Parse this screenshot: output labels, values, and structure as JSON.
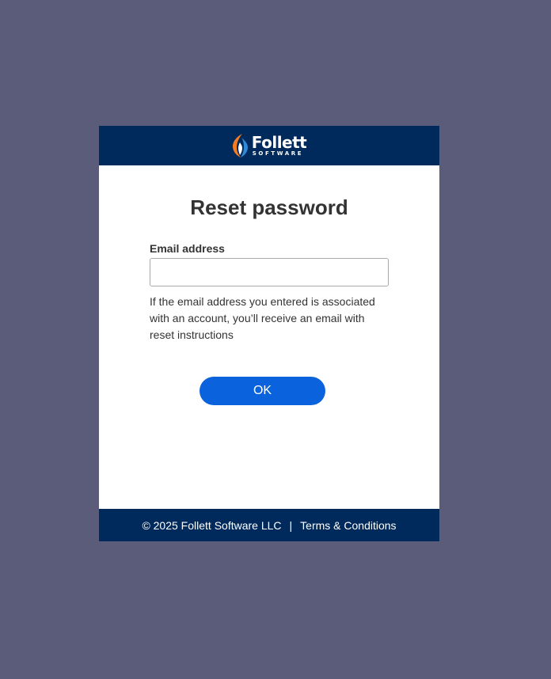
{
  "brand": {
    "name": "Follett",
    "sub": "SOFTWARE",
    "colors": {
      "header_bg": "#012a5c",
      "page_bg": "#5b5b7a",
      "logo_orange": "#f47b20",
      "logo_blue": "#2f8ad8",
      "button_bg": "#0a63dc"
    }
  },
  "form": {
    "title": "Reset password",
    "email_label": "Email address",
    "email_value": "",
    "help_text": "If the email address you entered is associated with an account, you’ll receive an email with reset instructions",
    "ok_label": "OK"
  },
  "footer": {
    "copyright": "© 2025 Follett Software LLC",
    "separator": "|",
    "terms_label": "Terms & Conditions"
  }
}
